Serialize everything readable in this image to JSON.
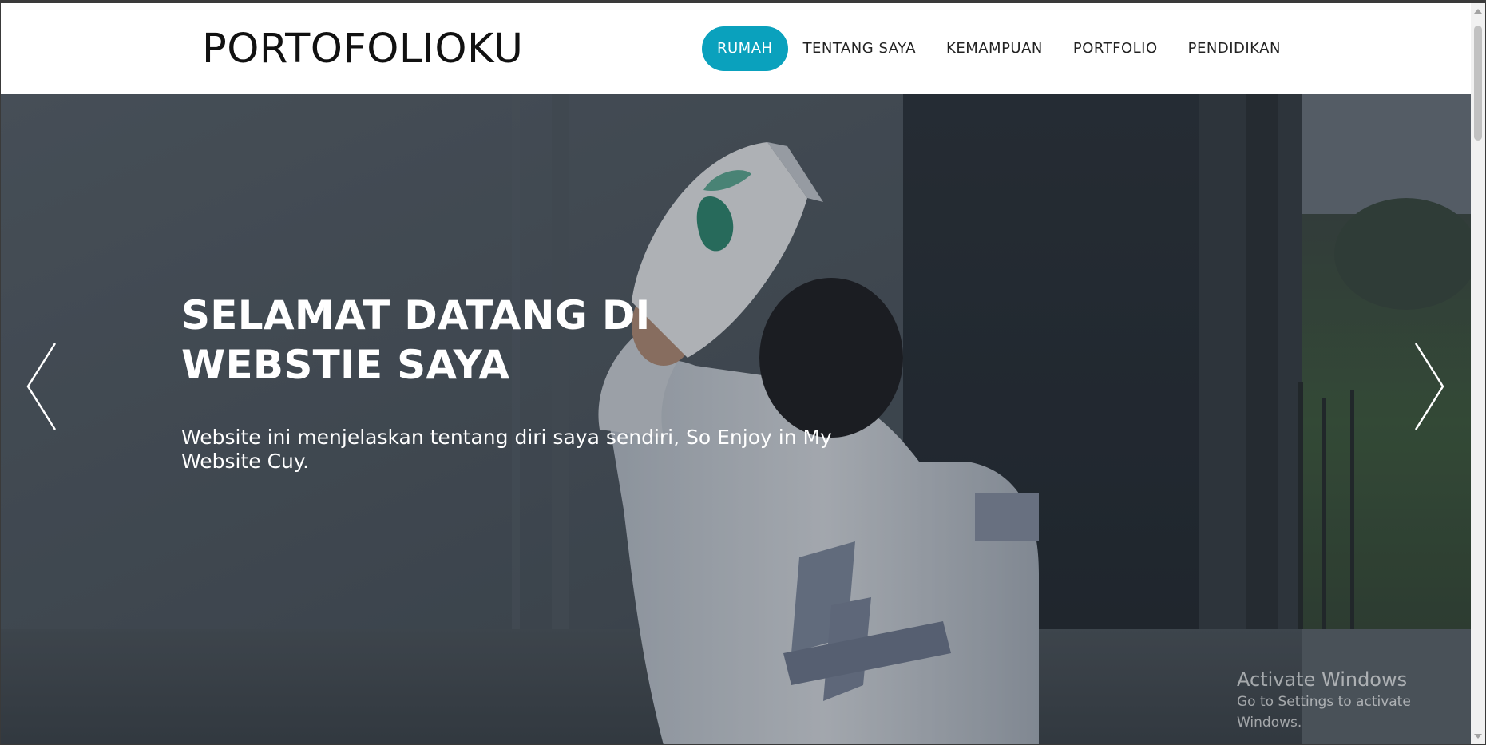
{
  "brand": {
    "title": "PORTOFOLIOKU"
  },
  "nav": {
    "items": [
      {
        "label": "RUMAH",
        "active": true
      },
      {
        "label": "TENTANG SAYA",
        "active": false
      },
      {
        "label": "KEMAMPUAN",
        "active": false
      },
      {
        "label": "PORTFOLIO",
        "active": false
      },
      {
        "label": "PENDIDIKAN",
        "active": false
      }
    ]
  },
  "hero": {
    "title": "SELAMAT DATANG DI WEBSTIE SAYA",
    "subtitle": "Website ini menjelaskan tentang diri saya sendiri, So Enjoy in My Website Cuy.",
    "prev_icon": "chevron-left-icon",
    "next_icon": "chevron-right-icon"
  },
  "watermark": {
    "title": "Activate Windows",
    "subtitle": "Go to Settings to activate Windows."
  },
  "colors": {
    "accent": "#0aa1bd",
    "nav_text": "#222222",
    "hero_text": "#ffffff"
  }
}
